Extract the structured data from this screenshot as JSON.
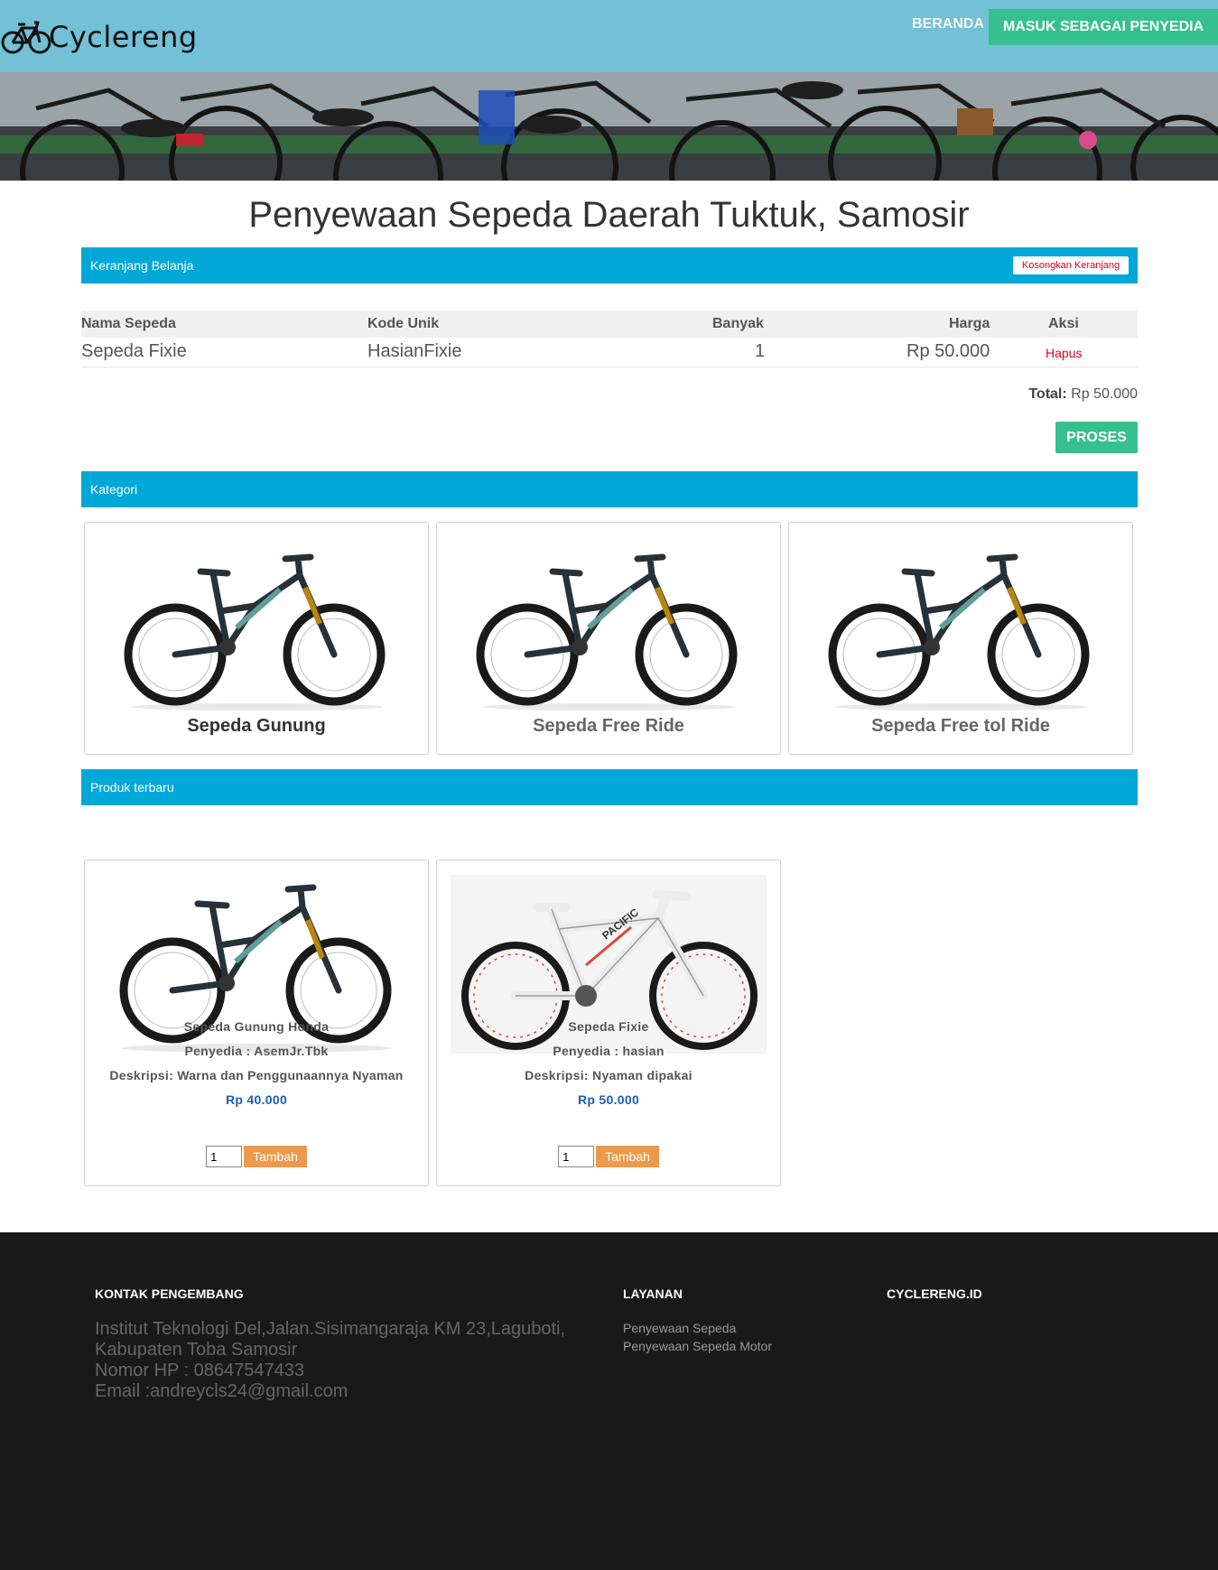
{
  "navbar": {
    "brand": "Cyclereng",
    "home_label": "BERANDA",
    "provider_label": "MASUK SEBAGAI PENYEDIA"
  },
  "page_title": "Penyewaan Sepeda Daerah Tuktuk, Samosir",
  "cart": {
    "panel_title": "Keranjang Belanja",
    "clear_label": "Kosongkan Keranjang",
    "headers": {
      "name": "Nama Sepeda",
      "code": "Kode Unik",
      "qty": "Banyak",
      "price": "Harga",
      "action": "Aksi"
    },
    "rows": [
      {
        "name": "Sepeda Fixie",
        "code": "HasianFixie",
        "qty": "1",
        "price": "Rp 50.000",
        "action": "Hapus"
      }
    ],
    "total_label": "Total:",
    "total_value": "Rp 50.000",
    "proses_label": "PROSES"
  },
  "kategori": {
    "panel_title": "Kategori",
    "items": [
      {
        "title": "Sepeda Gunung"
      },
      {
        "title": "Sepeda Free Ride"
      },
      {
        "title": "Sepeda Free tol Ride"
      }
    ]
  },
  "produk": {
    "panel_title": "Produk terbaru",
    "items": [
      {
        "name": "Sepeda Gunung Honda",
        "provider": "Penyedia : AsemJr.Tbk",
        "description": "Deskripsi: Warna dan Penggunaannya Nyaman",
        "price": "Rp 40.000",
        "qty": "1",
        "add_label": "Tambah"
      },
      {
        "name": "Sepeda Fixie",
        "provider": "Penyedia : hasian",
        "description": "Deskripsi: Nyaman dipakai",
        "price": "Rp 50.000",
        "qty": "1",
        "add_label": "Tambah"
      }
    ]
  },
  "footer": {
    "contact_heading": "KONTAK PENGEMBANG",
    "contact_lines": [
      "Institut Teknologi Del,Jalan.Sisimangaraja KM 23,Laguboti,",
      "Kabupaten Toba Samosir",
      "Nomor HP : 08647547433",
      "Email :andreycls24@gmail.com"
    ],
    "services_heading": "LAYANAN",
    "services": [
      "Penyewaan Sepeda",
      "Penyewaan Sepeda Motor"
    ],
    "site_heading": "CYCLERENG.ID"
  },
  "colors": {
    "navbar": "#72c1d7",
    "panel": "#00a8d8",
    "success": "#36c08f",
    "add_button": "#eb9a4b",
    "price": "#1a5fb4",
    "footer": "#191919"
  }
}
